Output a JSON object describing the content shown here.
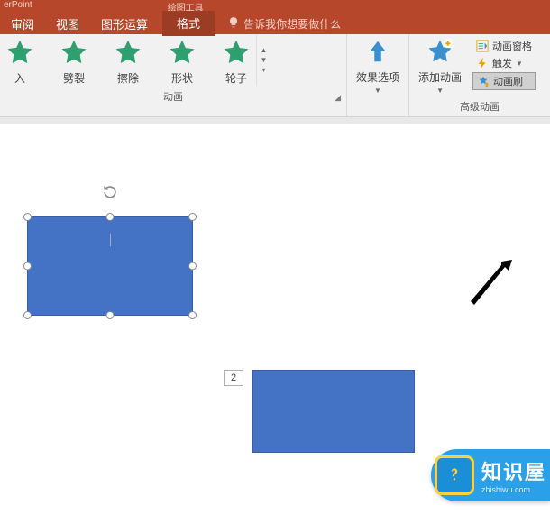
{
  "titles": {
    "app": "erPoint",
    "tool_tab_title": "绘图工具"
  },
  "tabs": {
    "review": "审阅",
    "view": "视图",
    "shapeop": "图形运算",
    "format": "格式"
  },
  "tell_me": "告诉我你想要做什么",
  "anim_effects": {
    "enter": "入",
    "split": "劈裂",
    "wipe": "擦除",
    "shape": "形状",
    "wheel": "轮子"
  },
  "anim_group_label": "动画",
  "effect_options": "效果选项",
  "add_anim": "添加动画",
  "adv": {
    "pane": "动画窗格",
    "trigger": "触发",
    "painter": "动画刷",
    "group_label": "高级动画"
  },
  "slide": {
    "num_badge": "2"
  },
  "watermark": {
    "title": "知识屋",
    "url": "zhishiwu.com"
  }
}
